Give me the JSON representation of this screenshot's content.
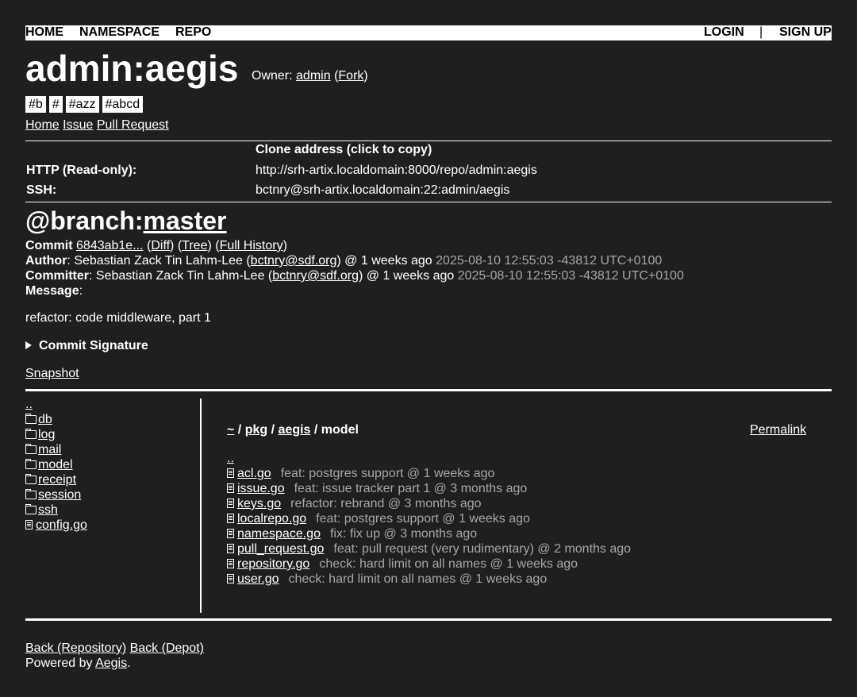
{
  "nav": {
    "home": "HOME",
    "namespace": "NAMESPACE",
    "repo": "REPO",
    "login": "LOGIN",
    "sep": "|",
    "signup": "SIGN UP"
  },
  "repo": {
    "title": "admin:aegis",
    "owner_label": "Owner:",
    "owner": "admin",
    "fork": "Fork"
  },
  "tags": [
    "#b",
    "#",
    "#azz",
    "#abcd"
  ],
  "subnav": {
    "home": "Home",
    "issue": "Issue",
    "pull_request": "Pull Request"
  },
  "clone": {
    "header": "Clone address (click to copy)",
    "http_label": "HTTP (Read-only):",
    "http_value": "http://srh-artix.localdomain:8000/repo/admin:aegis",
    "ssh_label": "SSH:",
    "ssh_value": "bctnry@srh-artix.localdomain:22:admin/aegis"
  },
  "branch": {
    "prefix": "@branch:",
    "name": "master"
  },
  "commit": {
    "label": "Commit",
    "hash": "6843ab1e...",
    "diff": "Diff",
    "tree": "Tree",
    "full_history": "Full History",
    "author_label": "Author",
    "author_name": ": Sebastian Zack Tin Lahm-Lee (",
    "author_email": "bctnry@sdf.org",
    "author_when": ") @ 1 weeks ago",
    "author_ts": "2025-08-10 12:55:03 -43812 UTC+0100",
    "committer_label": "Committer",
    "committer_name": ": Sebastian Zack Tin Lahm-Lee (",
    "committer_email": "bctnry@sdf.org",
    "committer_when": ") @ 1 weeks ago",
    "committer_ts": "2025-08-10 12:55:03 -43812 UTC+0100",
    "message_label": "Message",
    "message_text": "refactor: code middleware, part 1",
    "signature": "Commit Signature",
    "snapshot": "Snapshot"
  },
  "left_tree": {
    "parent": "..",
    "items": [
      {
        "name": "db",
        "type": "folder"
      },
      {
        "name": "log",
        "type": "folder"
      },
      {
        "name": "mail",
        "type": "folder"
      },
      {
        "name": "model",
        "type": "folder"
      },
      {
        "name": "receipt",
        "type": "folder"
      },
      {
        "name": "session",
        "type": "folder"
      },
      {
        "name": "ssh",
        "type": "folder"
      },
      {
        "name": "config.go",
        "type": "file"
      }
    ]
  },
  "path": {
    "root": "~",
    "sep": "/",
    "seg1": "pkg",
    "seg2": "aegis",
    "current": "model",
    "permalink": "Permalink"
  },
  "files": {
    "parent": "..",
    "items": [
      {
        "name": "acl.go",
        "msg": "feat: postgres support @ 1 weeks ago"
      },
      {
        "name": "issue.go",
        "msg": "feat: issue tracker part 1 @ 3 months ago"
      },
      {
        "name": "keys.go",
        "msg": "refactor: rebrand @ 3 months ago"
      },
      {
        "name": "localrepo.go",
        "msg": "feat: postgres support @ 1 weeks ago"
      },
      {
        "name": "namespace.go",
        "msg": "fix: fix up @ 3 months ago"
      },
      {
        "name": "pull_request.go",
        "msg": "feat: pull request (very rudimentary) @ 2 months ago"
      },
      {
        "name": "repository.go",
        "msg": "check: hard limit on all names @ 1 weeks ago"
      },
      {
        "name": "user.go",
        "msg": "check: hard limit on all names @ 1 weeks ago"
      }
    ]
  },
  "footer": {
    "back_repo": "Back (Repository)",
    "back_depot": "Back (Depot)",
    "powered_by": "Powered by",
    "aegis": "Aegis",
    "period": "."
  }
}
